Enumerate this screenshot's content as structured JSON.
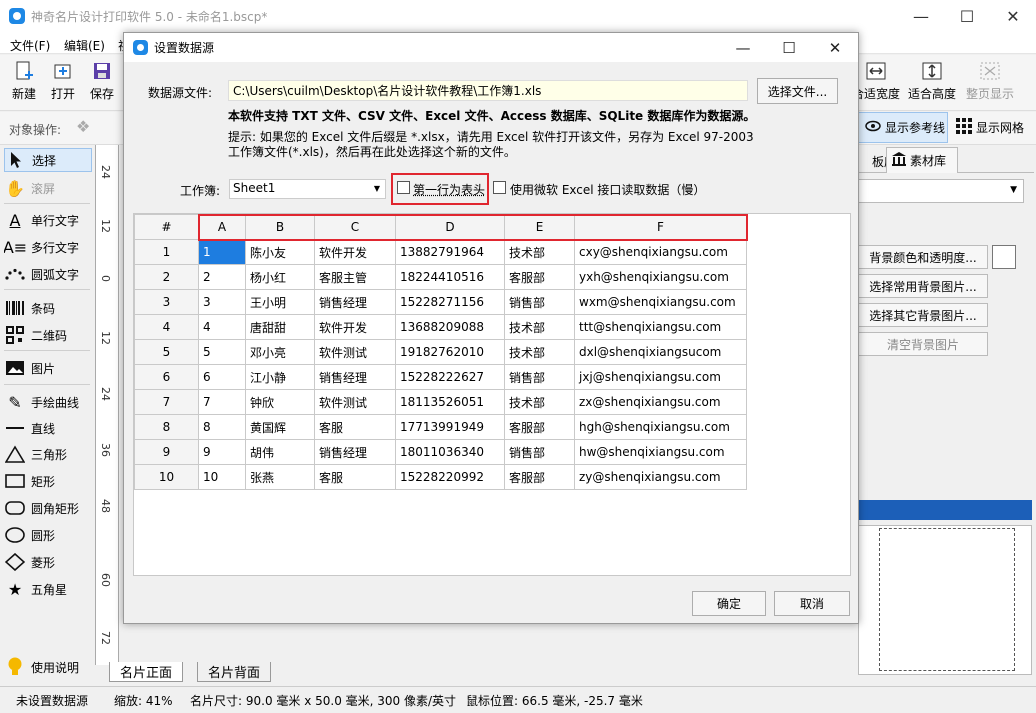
{
  "app": {
    "title": "神奇名片设计打印软件 5.0 - 未命名1.bscp*",
    "window_controls": {
      "minimize": "—",
      "maximize": "☐",
      "close": "✕"
    }
  },
  "menu": [
    "文件(F)",
    "编辑(E)",
    "视"
  ],
  "toolbar": {
    "left_buttons": [
      {
        "label": "新建",
        "icon": "new-file-icon"
      },
      {
        "label": "打开",
        "icon": "open-folder-icon"
      },
      {
        "label": "保存",
        "icon": "save-disk-icon"
      }
    ],
    "right_buttons": [
      {
        "label": "合适宽度",
        "icon": "fit-width-icon"
      },
      {
        "label": "适合高度",
        "icon": "fit-height-icon"
      },
      {
        "label": "整页显示",
        "icon": "fit-page-icon"
      }
    ]
  },
  "objbar": {
    "label": "对象操作:",
    "guide_toggle": "显示参考线",
    "grid_toggle": "显示网格"
  },
  "tools": [
    {
      "label": "选择",
      "icon": "cursor-icon"
    },
    {
      "label": "滚屏",
      "icon": "hand-icon"
    },
    {
      "label": "单行文字",
      "icon": "single-text-icon"
    },
    {
      "label": "多行文字",
      "icon": "multi-text-icon"
    },
    {
      "label": "圆弧文字",
      "icon": "arc-text-icon"
    },
    {
      "label": "条码",
      "icon": "barcode-icon"
    },
    {
      "label": "二维码",
      "icon": "qrcode-icon"
    },
    {
      "label": "图片",
      "icon": "image-icon"
    },
    {
      "label": "手绘曲线",
      "icon": "pen-icon"
    },
    {
      "label": "直线",
      "icon": "line-icon"
    },
    {
      "label": "三角形",
      "icon": "triangle-icon"
    },
    {
      "label": "矩形",
      "icon": "rectangle-icon"
    },
    {
      "label": "圆角矩形",
      "icon": "rounded-rect-icon"
    },
    {
      "label": "圆形",
      "icon": "circle-icon"
    },
    {
      "label": "菱形",
      "icon": "diamond-icon"
    },
    {
      "label": "五角星",
      "icon": "star-icon"
    }
  ],
  "help_label": "使用说明",
  "ruler_marks": [
    "24",
    "12",
    "0",
    "12",
    "24",
    "36",
    "48",
    "60",
    "72"
  ],
  "right_panel": {
    "tab_partial": "板库",
    "tab_material": "素材库",
    "btn_bg_color": "背景颜色和透明度...",
    "btn_bg_common": "选择常用背景图片...",
    "btn_bg_other": "选择其它背景图片...",
    "btn_clear_bg": "清空背景图片"
  },
  "page_tabs": [
    "名片正面",
    "名片背面"
  ],
  "status": {
    "datasource": "未设置数据源",
    "zoom": "缩放: 41%",
    "card_size": "名片尺寸: 90.0 毫米 x 50.0 毫米, 300 像素/英寸",
    "mouse_pos": "鼠标位置: 66.5 毫米, -25.7 毫米"
  },
  "dialog": {
    "title": "设置数据源",
    "file_label": "数据源文件:",
    "file_path": "C:\\Users\\cuilm\\Desktop\\名片设计软件教程\\工作簿1.xls",
    "choose_file_button": "选择文件...",
    "support_note": "本软件支持 TXT 文件、CSV 文件、Excel 文件、Access 数据库、SQLite 数据库作为数据源。",
    "hint_line1": "提示: 如果您的 Excel 文件后缀是 *.xlsx，请先用 Excel 软件打开该文件，另存为 Excel 97-2003",
    "hint_line2": "工作簿文件(*.xls)，然后再在此处选择这个新的文件。",
    "sheet_label": "工作簿:",
    "sheet_value": "Sheet1",
    "first_row_header": "第一行为表头",
    "use_ms_excel": "使用微软 Excel 接口读取数据（慢）",
    "ok_button": "确定",
    "cancel_button": "取消",
    "table": {
      "corner": "#",
      "columns": [
        "A",
        "B",
        "C",
        "D",
        "E",
        "F"
      ],
      "rows": [
        {
          "n": "1",
          "cells": [
            "1",
            "陈小友",
            "软件开发",
            "13882791964",
            "技术部",
            "cxy@shenqixiangsu.com"
          ]
        },
        {
          "n": "2",
          "cells": [
            "2",
            "杨小红",
            "客服主管",
            "18224410516",
            "客服部",
            "yxh@shenqixiangsu.com"
          ]
        },
        {
          "n": "3",
          "cells": [
            "3",
            "王小明",
            "销售经理",
            "15228271156",
            "销售部",
            "wxm@shenqixiangsu.com"
          ]
        },
        {
          "n": "4",
          "cells": [
            "4",
            "唐甜甜",
            "软件开发",
            "13688209088",
            "技术部",
            "ttt@shenqixiangsu.com"
          ]
        },
        {
          "n": "5",
          "cells": [
            "5",
            "邓小亮",
            "软件测试",
            "19182762010",
            "技术部",
            "dxl@shenqixiangsucom"
          ]
        },
        {
          "n": "6",
          "cells": [
            "6",
            "江小静",
            "销售经理",
            "15228222627",
            "销售部",
            "jxj@shenqixiangsu.com"
          ]
        },
        {
          "n": "7",
          "cells": [
            "7",
            "钟欣",
            "软件测试",
            "18113526051",
            "技术部",
            "zx@shenqixiangsu.com"
          ]
        },
        {
          "n": "8",
          "cells": [
            "8",
            "黄国辉",
            "客服",
            "17713991949",
            "客服部",
            "hgh@shenqixiangsu.com"
          ]
        },
        {
          "n": "9",
          "cells": [
            "9",
            "胡伟",
            "销售经理",
            "18011036340",
            "销售部",
            "hw@shenqixiangsu.com"
          ]
        },
        {
          "n": "10",
          "cells": [
            "10",
            "张燕",
            "客服",
            "15228220992",
            "客服部",
            "zy@shenqixiangsu.com"
          ]
        }
      ]
    }
  },
  "colors": {
    "accent": "#1e7de0",
    "highlight_box": "#e0262f",
    "path_bg": "#ffffe8",
    "panel_header": "#1c5fb8"
  }
}
